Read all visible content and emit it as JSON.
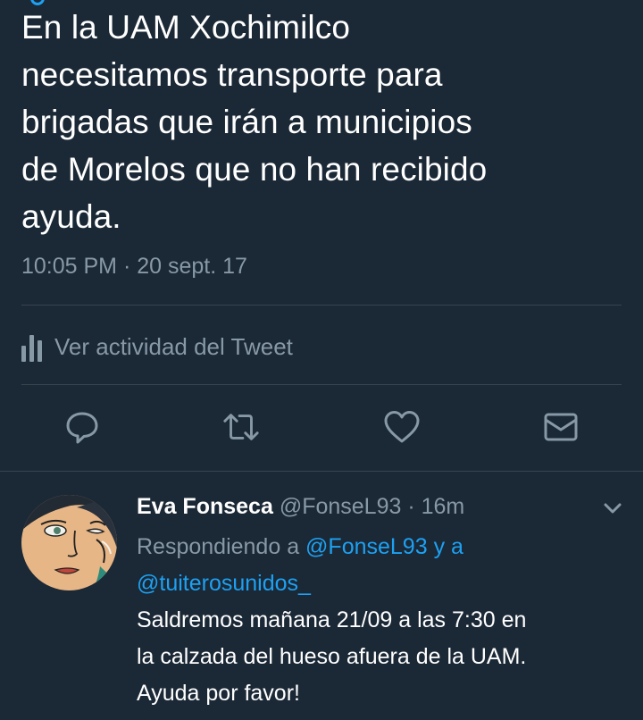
{
  "tweet": {
    "lines": [
      "En la UAM Xochimilco",
      "necesitamos transporte para",
      "brigadas que irán a municipios",
      "de Morelos que no han recibido",
      "ayuda."
    ],
    "time": "10:05 PM",
    "separator": "·",
    "date": "20 sept. 17"
  },
  "activity": {
    "label": "Ver actividad del Tweet",
    "icon": "analytics-bars-icon"
  },
  "actions": {
    "reply_icon": "reply-icon",
    "retweet_icon": "retweet-icon",
    "like_icon": "heart-icon",
    "dm_icon": "envelope-icon"
  },
  "reply": {
    "name": "Eva Fonseca",
    "handle": "@FonseL93",
    "separator": "·",
    "time": "16m",
    "replying_prefix": "Respondiendo a",
    "replying_user1": "@FonseL93",
    "replying_and": "y a",
    "replying_user2": "@tuiterosunidos_",
    "body_lines": [
      "Saldremos mañana 21/09 a las 7:30 en",
      "la calzada del hueso afuera de la UAM.",
      "Ayuda por favor!"
    ]
  },
  "colors": {
    "background": "#1b2836",
    "text": "#ffffff",
    "secondary": "#8899a6",
    "link": "#1da1f2",
    "divider": "#38444d"
  }
}
